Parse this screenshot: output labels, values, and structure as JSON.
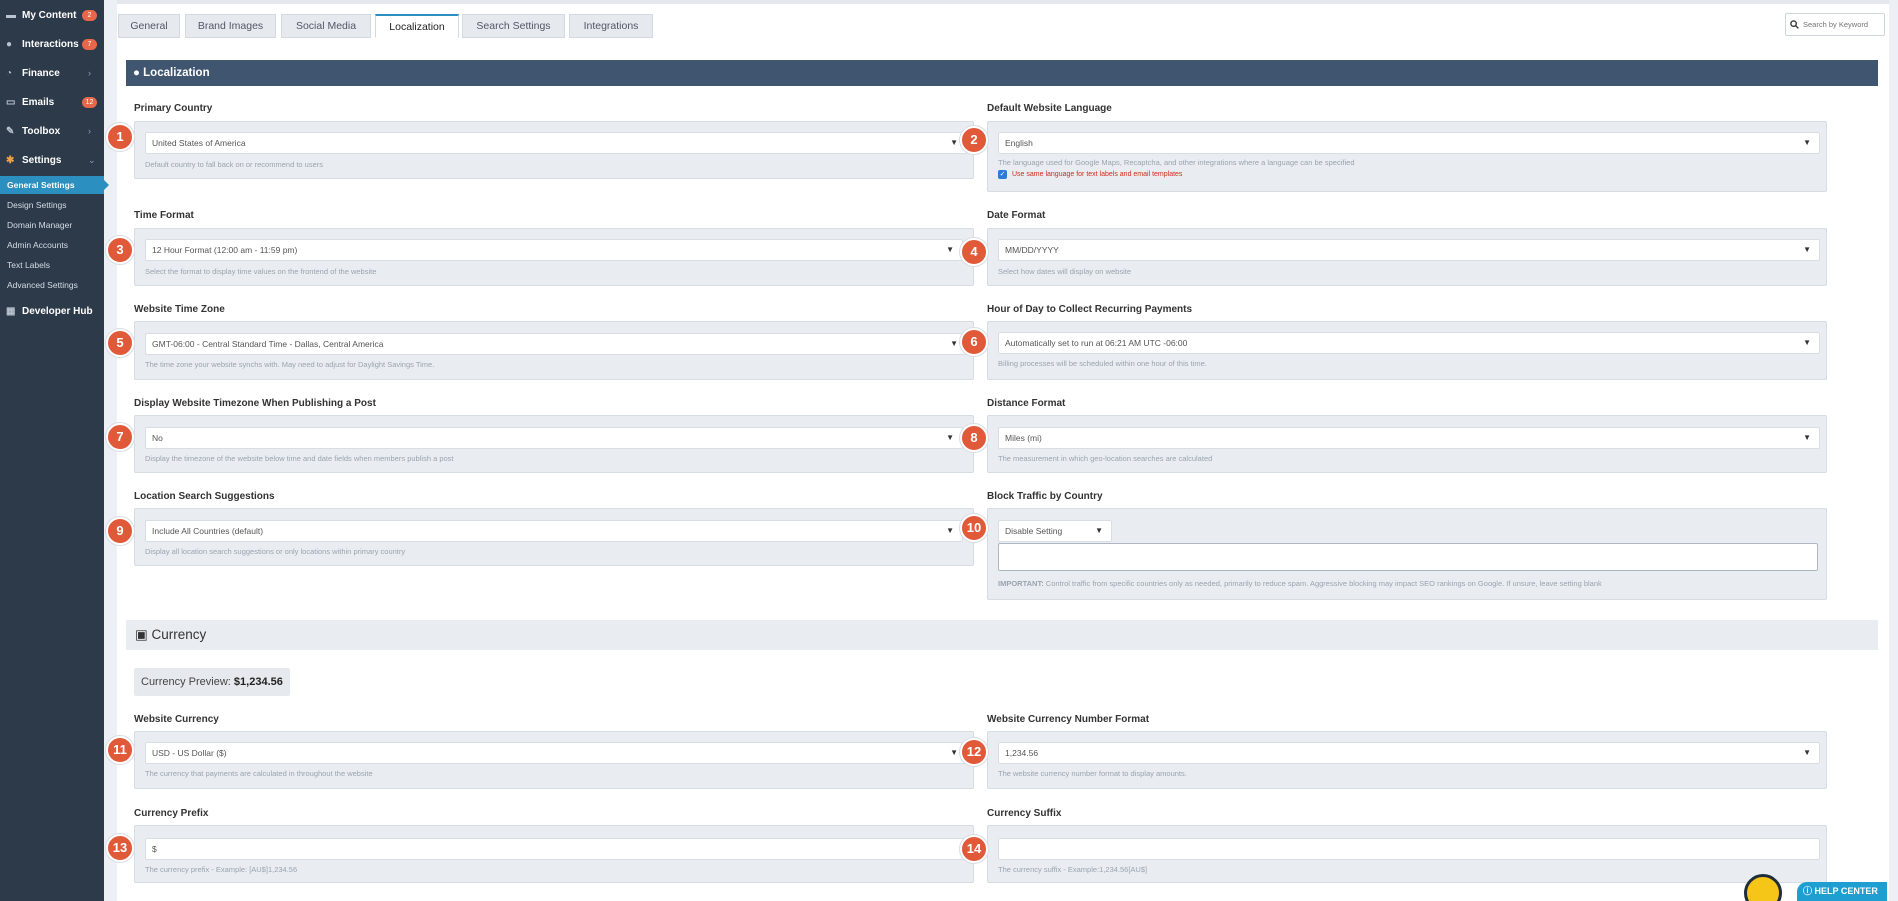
{
  "sidebar": {
    "items": [
      {
        "label": "My Content",
        "icon": "folder-icon",
        "badge": "2"
      },
      {
        "label": "Interactions",
        "icon": "chat-icon",
        "badge": "7"
      },
      {
        "label": "Finance",
        "icon": "pie-chart-icon"
      },
      {
        "label": "Emails",
        "icon": "inbox-icon",
        "badge": "12"
      },
      {
        "label": "Toolbox",
        "icon": "wrench-icon"
      },
      {
        "label": "Settings",
        "icon": "gear-icon"
      },
      {
        "label": "Developer Hub",
        "icon": "grid-icon"
      }
    ],
    "settings_sub": [
      "General Settings",
      "Design Settings",
      "Domain Manager",
      "Admin Accounts",
      "Text Labels",
      "Advanced Settings"
    ]
  },
  "tabs": [
    "General",
    "Brand Images",
    "Social Media",
    "Localization",
    "Search Settings",
    "Integrations"
  ],
  "active_tab": "Localization",
  "search": {
    "placeholder": "Search by Keyword"
  },
  "localization": {
    "title": "Localization",
    "fields": {
      "primary_country": {
        "num": "1",
        "label": "Primary Country",
        "value": "United States of America",
        "help": "Default country to fall back on or recommend to users"
      },
      "default_language": {
        "num": "2",
        "label": "Default Website Language",
        "value": "English",
        "help": "The language used for Google Maps, Recaptcha, and other integrations where a language can be specified",
        "checkbox": "Use same language for text labels and email templates"
      },
      "time_format": {
        "num": "3",
        "label": "Time Format",
        "value": "12 Hour Format (12:00 am - 11:59 pm)",
        "help": "Select the format to display time values on the frontend of the website"
      },
      "date_format": {
        "num": "4",
        "label": "Date Format",
        "value": "MM/DD/YYYY",
        "help": "Select how dates will display on website"
      },
      "time_zone": {
        "num": "5",
        "label": "Website Time Zone",
        "value": "GMT-06:00 - Central Standard Time - Dallas, Central America",
        "help": "The time zone your website synchs with. May need to adjust for Daylight Savings Time."
      },
      "recurring_hour": {
        "num": "6",
        "label": "Hour of Day to Collect Recurring Payments",
        "value": "Automatically set to run at 06:21 AM UTC -06:00",
        "help": "Billing processes will be scheduled within one hour of this time."
      },
      "display_timezone": {
        "num": "7",
        "label": "Display Website Timezone When Publishing a Post",
        "value": "No",
        "help": "Display the timezone of the website below time and date fields when members publish a post"
      },
      "distance_format": {
        "num": "8",
        "label": "Distance Format",
        "value": "Miles (mi)",
        "help": "The measurement in which geo-location searches are calculated"
      },
      "location_suggestions": {
        "num": "9",
        "label": "Location Search Suggestions",
        "value": "Include All Countries (default)",
        "help": "Display all location search suggestions or only locations within primary country"
      },
      "block_traffic": {
        "num": "10",
        "label": "Block Traffic by Country",
        "value": "Disable Setting",
        "help_strong": "IMPORTANT:",
        "help": "Control traffic from specific countries only as needed, primarily to reduce spam. Aggressive blocking may impact SEO rankings on Google. If unsure, leave setting blank"
      }
    }
  },
  "currency": {
    "title": "Currency",
    "preview_label": "Currency Preview:",
    "preview_value": "$1,234.56",
    "fields": {
      "website_currency": {
        "num": "11",
        "label": "Website Currency",
        "value": "USD - US Dollar ($)",
        "help": "The currency that payments are calculated in throughout the website"
      },
      "number_format": {
        "num": "12",
        "label": "Website Currency Number Format",
        "value": "1,234.56",
        "help": "The website currency number format to display amounts."
      },
      "prefix": {
        "num": "13",
        "label": "Currency Prefix",
        "value": "$",
        "help": "The currency prefix - Example: [AU$]1,234.56"
      },
      "suffix": {
        "num": "14",
        "label": "Currency Suffix",
        "value": "",
        "help": "The currency suffix - Example:1,234.56[AU$]"
      }
    }
  },
  "help_center": {
    "label": "HELP CENTER"
  },
  "colors": {
    "sidebar": "#2c3a4a",
    "accent": "#2b8fbf",
    "header": "#3f5570",
    "badge": "#e8674a",
    "marker": "#e05a3a"
  }
}
